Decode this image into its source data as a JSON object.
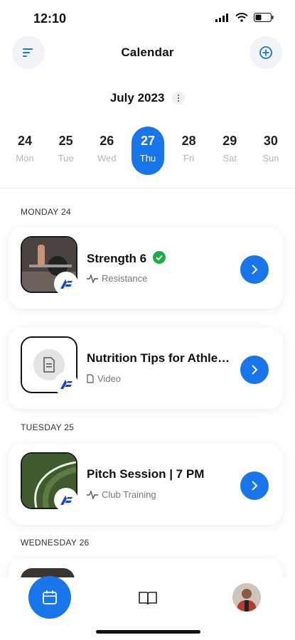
{
  "status": {
    "time": "12:10"
  },
  "header": {
    "title": "Calendar",
    "filter_icon": "filter-lines-icon",
    "add_icon": "plus-circle-icon"
  },
  "month": {
    "label": "July 2023"
  },
  "week": [
    {
      "num": "24",
      "wd": "Mon",
      "active": false
    },
    {
      "num": "25",
      "wd": "Tue",
      "active": false
    },
    {
      "num": "26",
      "wd": "Wed",
      "active": false
    },
    {
      "num": "27",
      "wd": "Thu",
      "active": true
    },
    {
      "num": "28",
      "wd": "Fri",
      "active": false
    },
    {
      "num": "29",
      "wd": "Sat",
      "active": false
    },
    {
      "num": "30",
      "wd": "Sun",
      "active": false
    }
  ],
  "sections": [
    {
      "label": "MONDAY 24"
    },
    {
      "label": "TUESDAY 25"
    },
    {
      "label": "WEDNESDAY 26"
    }
  ],
  "sessions": [
    {
      "title": "Strength 6",
      "type": "Resistance",
      "completed": true,
      "type_icon": "activity-icon"
    },
    {
      "title": "Nutrition Tips for Athle…",
      "type": "Video",
      "completed": false,
      "type_icon": "document-icon"
    },
    {
      "title": "Pitch Session | 7 PM",
      "type": "Club Training",
      "completed": false,
      "type_icon": "activity-icon"
    }
  ],
  "colors": {
    "accent": "#1875ea",
    "success": "#1faa4b"
  },
  "tabbar": {
    "items": [
      "calendar-icon",
      "book-icon",
      "profile-avatar"
    ]
  }
}
